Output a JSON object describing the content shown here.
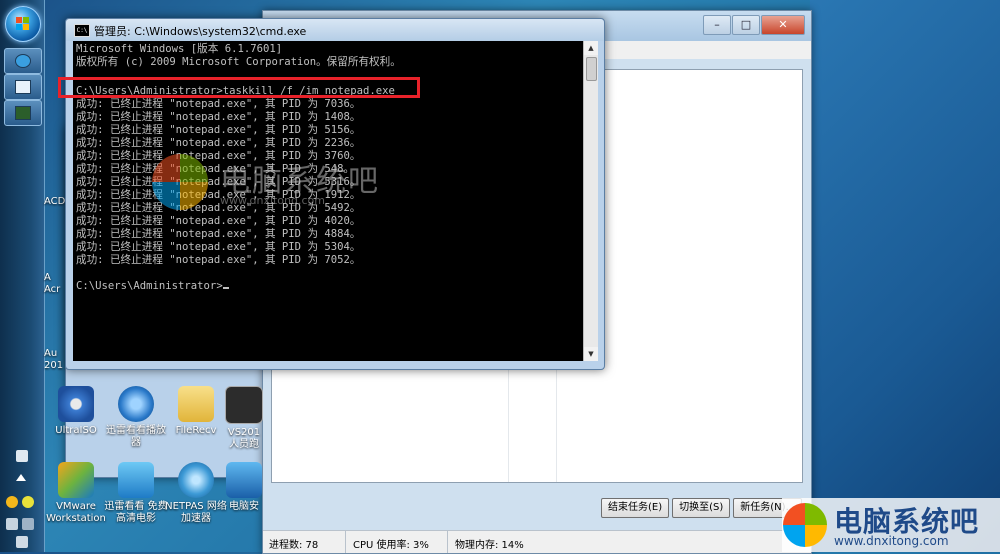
{
  "cmd": {
    "title": "管理员: C:\\Windows\\system32\\cmd.exe",
    "icon_text": "C:\\",
    "lines": [
      "Microsoft Windows [版本 6.1.7601]",
      "版权所有 (c) 2009 Microsoft Corporation。保留所有权利。",
      "",
      "C:\\Users\\Administrator>taskkill /f /im notepad.exe",
      "成功: 已终止进程 \"notepad.exe\", 其 PID 为 7036。",
      "成功: 已终止进程 \"notepad.exe\", 其 PID 为 1408。",
      "成功: 已终止进程 \"notepad.exe\", 其 PID 为 5156。",
      "成功: 已终止进程 \"notepad.exe\", 其 PID 为 2236。",
      "成功: 已终止进程 \"notepad.exe\", 其 PID 为 3760。",
      "成功: 已终止进程 \"notepad.exe\", 其 PID 为 548。",
      "成功: 已终止进程 \"notepad.exe\", 其 PID 为 5316。",
      "成功: 已终止进程 \"notepad.exe\", 其 PID 为 1912。",
      "成功: 已终止进程 \"notepad.exe\", 其 PID 为 5492。",
      "成功: 已终止进程 \"notepad.exe\", 其 PID 为 4020。",
      "成功: 已终止进程 \"notepad.exe\", 其 PID 为 4884。",
      "成功: 已终止进程 \"notepad.exe\", 其 PID 为 5304。",
      "成功: 已终止进程 \"notepad.exe\", 其 PID 为 7052。",
      "",
      "C:\\Users\\Administrator>"
    ]
  },
  "taskmgr": {
    "buttons": {
      "end_task": "结束任务(E)",
      "switch_to": "切换至(S)",
      "new_task": "新任务(N)..."
    },
    "status": {
      "processes": "进程数: 78",
      "cpu": "CPU 使用率: 3%",
      "memory": "物理内存: 14%"
    }
  },
  "desktop": {
    "icons": [
      {
        "label": "UltraISO"
      },
      {
        "label": "迅雷看看播放器"
      },
      {
        "label": "FileRecv"
      },
      {
        "label": "VS201 人员跑"
      },
      {
        "label": "VMware Workstation"
      },
      {
        "label": "迅雷看看 免费高清电影"
      },
      {
        "label": "NETPAS 网络加速器"
      },
      {
        "label": "电脑安"
      }
    ],
    "side_labels": [
      "ACD 8",
      "A Acr",
      "Au 201"
    ]
  },
  "watermark": {
    "center_text": "电脑系统吧",
    "center_url": "www.dnxitong.com",
    "corner_text": "电脑系统吧",
    "corner_url": "www.dnxitong.com"
  },
  "colors": {
    "highlight": "#e8222a",
    "console_bg": "#000000",
    "console_fg": "#c0c0c0"
  }
}
